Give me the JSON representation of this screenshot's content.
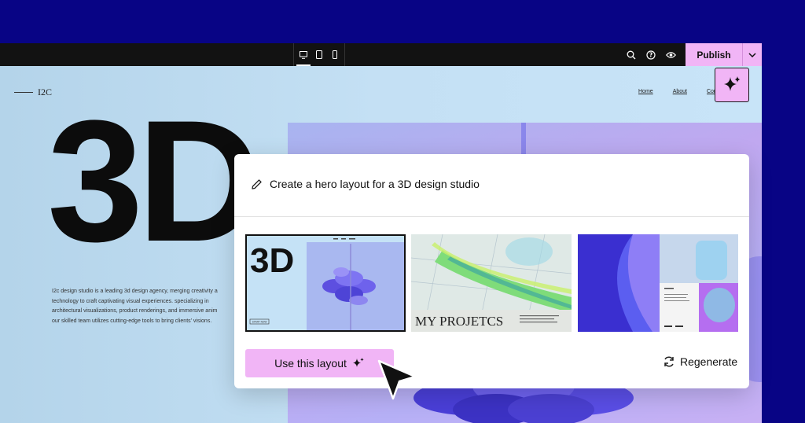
{
  "toolbar": {
    "devices": [
      "desktop-icon",
      "tablet-icon",
      "mobile-icon"
    ],
    "tools": [
      "search-icon",
      "help-icon",
      "preview-icon"
    ],
    "publish_label": "Publish"
  },
  "site": {
    "logo": "I2C",
    "nav": [
      "Home",
      "About",
      "Contact Us"
    ],
    "hero_title": "3D",
    "description": "I2c design studio is a leading 3d design agency, merging creativity a\ntechnology to craft captivating visual experiences. specializing in\narchitectural visualizations, product renderings, and immersive anim\nour skilled team utilizes cutting-edge tools to bring clients' visions."
  },
  "modal": {
    "prompt": "Create a hero layout for a 3D design studio",
    "thumbs": [
      {
        "title": "3D",
        "cta": "START NOW"
      },
      {
        "title": "MY PROJETCS"
      },
      {
        "title": ""
      }
    ],
    "use_label": "Use this layout",
    "regenerate_label": "Regenerate"
  },
  "colors": {
    "background": "#080485",
    "accent": "#f1b5f6",
    "toolbar": "#121212"
  }
}
